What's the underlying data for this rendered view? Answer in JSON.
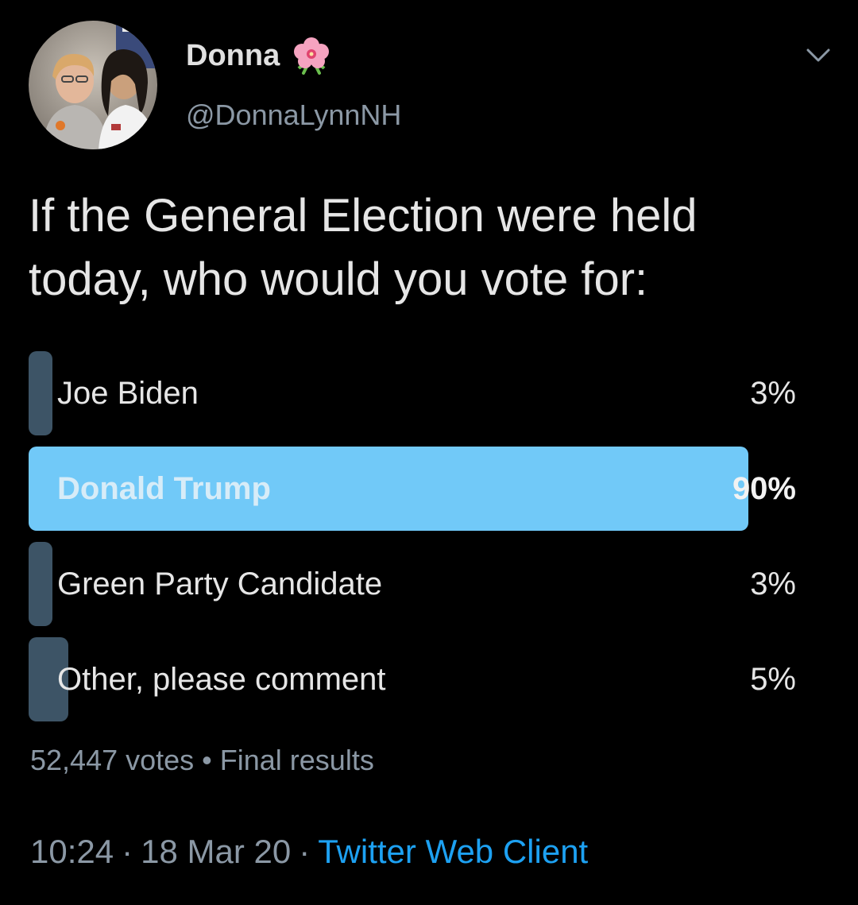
{
  "header": {
    "display_name": "Donna",
    "handle": "@DonnaLynnNH"
  },
  "tweet": {
    "text_line1": "If the General Election were held",
    "text_line2": "today, who would you vote for:"
  },
  "poll": {
    "options": [
      {
        "label": "Joe Biden",
        "percent_text": "3%",
        "percent": 3,
        "winner": false
      },
      {
        "label": "Donald Trump",
        "percent_text": "90%",
        "percent": 90,
        "winner": true
      },
      {
        "label": "Green Party Candidate",
        "percent_text": "3%",
        "percent": 3,
        "winner": false
      },
      {
        "label": "Other, please comment",
        "percent_text": "5%",
        "percent": 5,
        "winner": false
      }
    ],
    "votes": "52,447 votes",
    "separator": "•",
    "status": "Final results"
  },
  "footer": {
    "time": "10:24",
    "date": "18 Mar 20",
    "separator": "·",
    "source": "Twitter Web Client"
  },
  "colors": {
    "winner_bar": "#71c9f8",
    "loser_bar": "#3d5466",
    "link": "#1da1f2"
  },
  "icons": {
    "header_emoji": "hibiscus-flower-icon",
    "more": "chevron-down-icon"
  }
}
